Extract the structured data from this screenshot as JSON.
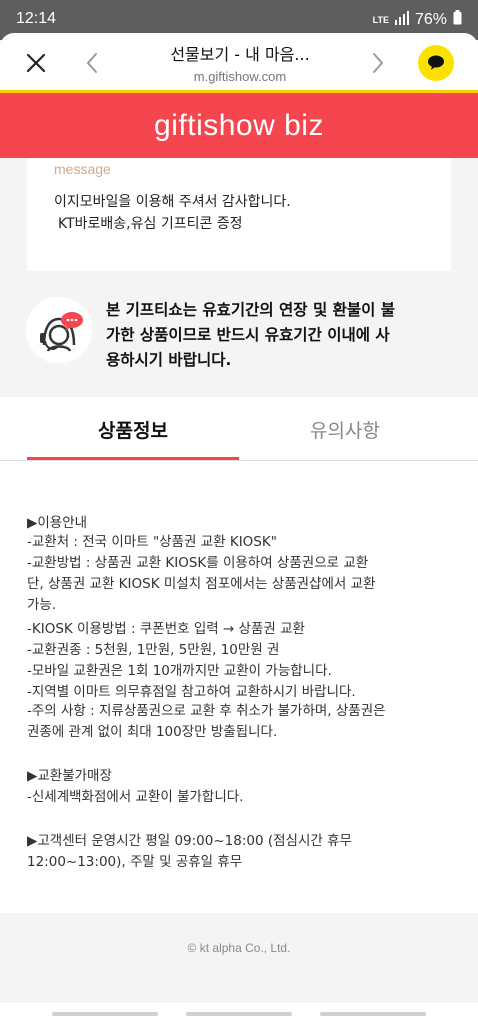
{
  "status_bar": {
    "time": "12:14",
    "network": "LTE",
    "battery": "76%"
  },
  "browser": {
    "title": "선물보기 - 내 마음...",
    "url": "m.giftishow.com"
  },
  "brand": {
    "name": "giftishow biz",
    "color": "#f5454f"
  },
  "message": {
    "label": "message",
    "lines": [
      "이지모바일을 이용해 주셔서 감사합니다.",
      "KT바로배송,유심 기프티콘 증정"
    ]
  },
  "notice": {
    "lines": [
      "본 기프티쇼는 유효기간의 연장 및 환불이 불",
      "가한 상품이므로 반드시 유효기간 이내에 사",
      "용하시기 바랍니다."
    ]
  },
  "tabs": [
    {
      "label": "상품정보",
      "active": true
    },
    {
      "label": "유의사항",
      "active": false
    }
  ],
  "product_info": {
    "lines": [
      "▶이용안내",
      "-교환처 : 전국 이마트 \"상품권 교환 KIOSK\"",
      "-교환방법 : 상품권 교환 KIOSK를 이용하여 상품권으로 교환",
      "단, 상품권 교환 KIOSK 미설치 점포에서는 상품권샵에서 교환",
      "가능.",
      "-KIOSK 이용방법 : 쿠폰번호 입력 → 상품권 교환",
      "-교환권종 : 5천원, 1만원, 5만원, 10만원 권",
      "-모바일 교환권은 1회 10개까지만 교환이 가능합니다.",
      "-지역별 이마트 의무휴점일 참고하여 교환하시기 바랍니다.",
      "-주의 사항 : 지류상품권으로 교환 후 취소가 불가하며, 상품권은",
      "권종에 관계 없이 최대 100장만 방출됩니다.",
      "▶교환불가매장",
      "-신세계백화점에서 교환이 불가합니다.",
      "▶고객센터 운영시간 평일 09:00~18:00 (점심시간 휴무",
      "12:00~13:00), 주말 및 공휴일 휴무"
    ]
  },
  "footer": {
    "copyright": "© kt alpha Co., Ltd."
  }
}
